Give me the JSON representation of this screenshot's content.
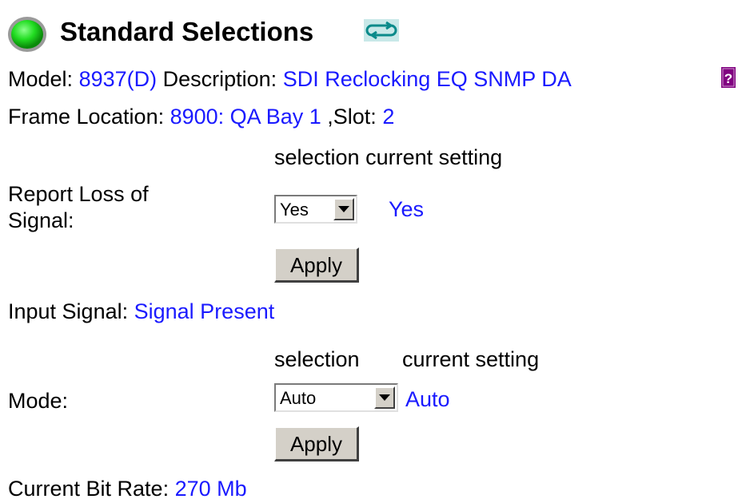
{
  "header": {
    "title": "Standard Selections",
    "status_led_color": "#22dd22",
    "status_icon": "status-led-icon",
    "refresh_icon": "refresh-icon",
    "help_icon": "help-icon",
    "help_glyph": "?"
  },
  "info": {
    "model_label": "Model:",
    "model_value": "8937(D)",
    "description_label": "Description:",
    "description_value": "SDI Reclocking EQ SNMP DA",
    "frame_label": "Frame Location:",
    "frame_value": "8900: QA Bay 1",
    "slot_separator": ",",
    "slot_label": "Slot:",
    "slot_value": "2"
  },
  "loss_of_signal": {
    "column_header": "selection current setting",
    "label_line1": "Report Loss of",
    "label_line2": "Signal:",
    "selected": "Yes",
    "current": "Yes",
    "apply_label": "Apply"
  },
  "input_signal": {
    "label": "Input Signal:",
    "value": "Signal Present"
  },
  "mode": {
    "column_header_selection": "selection",
    "column_header_current": "current setting",
    "label": "Mode:",
    "selected": "Auto",
    "current": "Auto",
    "apply_label": "Apply"
  },
  "bit_rate": {
    "label": "Current Bit Rate:",
    "value": "270 Mb"
  },
  "colors": {
    "value_text": "#1a1aff",
    "button_face": "#d4d0c8",
    "help_icon_bg": "#800080"
  }
}
